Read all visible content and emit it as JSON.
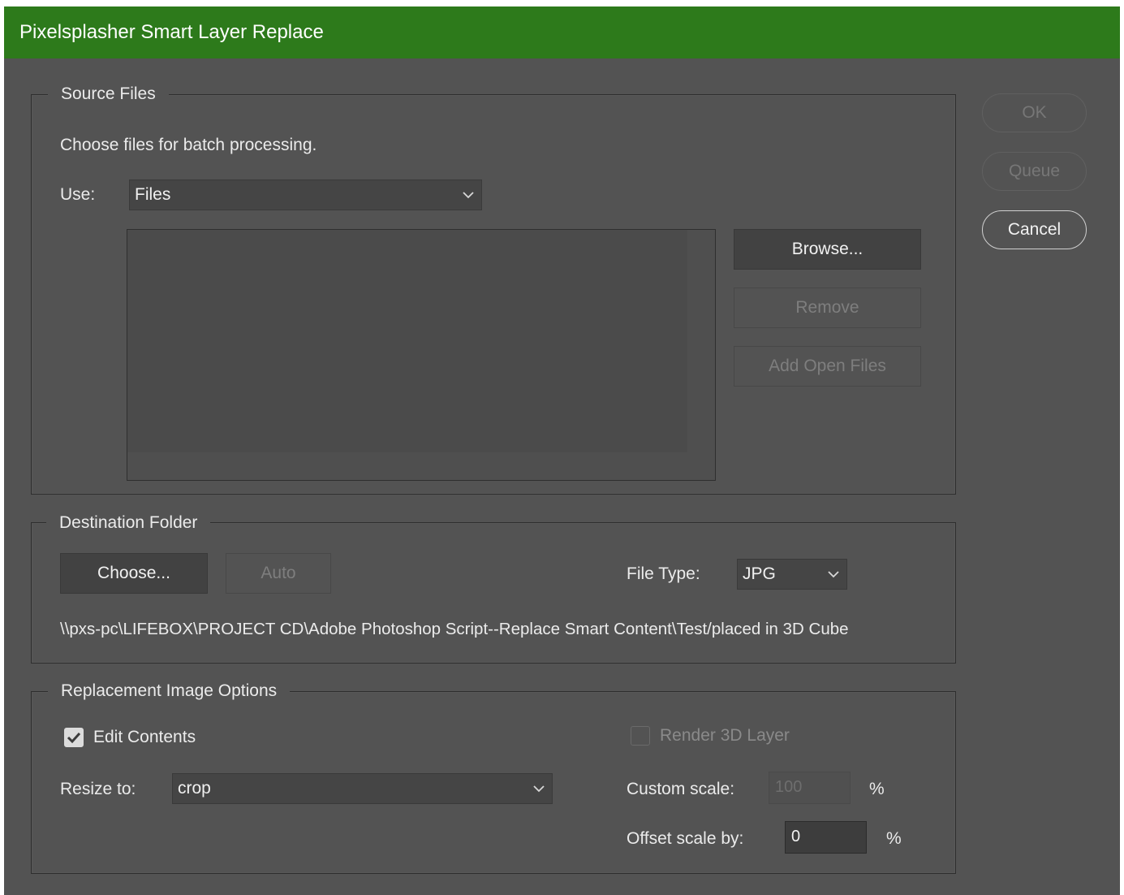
{
  "window": {
    "title": "Pixelsplasher Smart Layer Replace"
  },
  "source_files": {
    "legend": "Source Files",
    "description": "Choose files for batch processing.",
    "use_label": "Use:",
    "use_value": "Files",
    "browse_label": "Browse...",
    "remove_label": "Remove",
    "add_open_files_label": "Add Open Files"
  },
  "destination": {
    "legend": "Destination Folder",
    "choose_label": "Choose...",
    "auto_label": "Auto",
    "file_type_label": "File Type:",
    "file_type_value": "JPG",
    "path": "\\\\pxs-pc\\LIFEBOX\\PROJECT CD\\Adobe Photoshop Script--Replace Smart Content\\Test/placed in 3D Cube"
  },
  "replacement": {
    "legend": "Replacement Image Options",
    "edit_contents_label": "Edit Contents",
    "edit_contents_checked": true,
    "render_3d_label": "Render 3D Layer",
    "render_3d_checked": false,
    "resize_label": "Resize to:",
    "resize_value": "crop",
    "custom_scale_label": "Custom scale:",
    "custom_scale_value": "100",
    "custom_scale_unit": "%",
    "offset_scale_label": "Offset scale by:",
    "offset_scale_value": "0",
    "offset_scale_unit": "%"
  },
  "actions": {
    "ok_label": "OK",
    "queue_label": "Queue",
    "cancel_label": "Cancel"
  }
}
